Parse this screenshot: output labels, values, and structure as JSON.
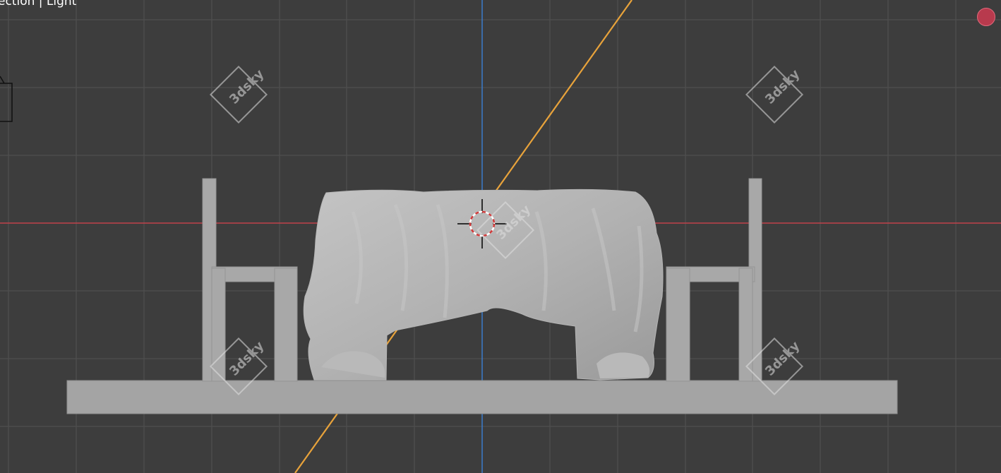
{
  "viewport": {
    "header_text": "ection | Light",
    "background_color": "#3d3d3d",
    "grid_color": "#4f4f4f",
    "x_axis_color": "#c0424b",
    "z_axis_color": "#3b79c4",
    "light_direction_color": "#e8a33b",
    "mesh_color": "#a8a8a8"
  },
  "watermark": {
    "text": "3dsky"
  },
  "icons": {
    "camera": "camera-object-icon",
    "cursor": "3d-cursor-icon",
    "record": "record-indicator-icon"
  },
  "scene_objects": [
    "tablecloth",
    "chair-left",
    "chair-right",
    "floor-slab"
  ]
}
